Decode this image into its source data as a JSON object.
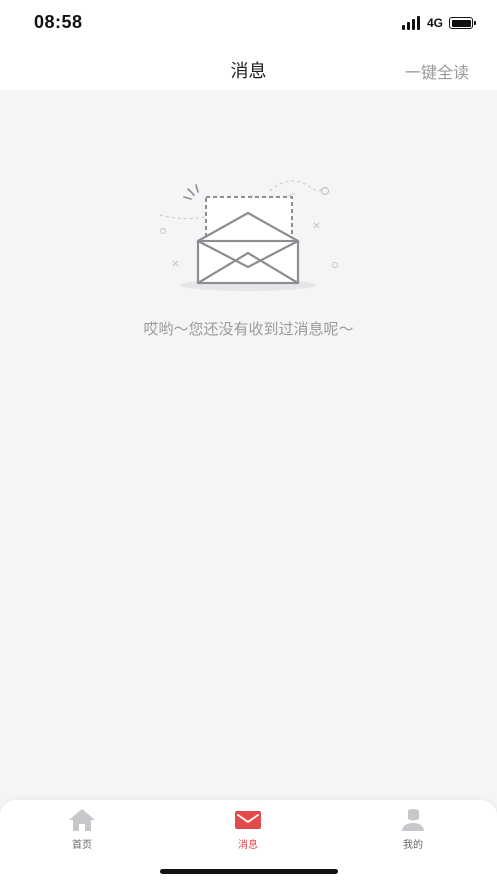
{
  "status_bar": {
    "time": "08:58",
    "network": "4G"
  },
  "nav": {
    "title": "消息",
    "action_label": "一键全读"
  },
  "empty_state": {
    "message": "哎哟～您还没有收到过消息呢～",
    "icon": "open-envelope-icon"
  },
  "tab_bar": {
    "active_color": "#e24b4b",
    "items": [
      {
        "label": "首页",
        "icon": "home-icon",
        "active": false
      },
      {
        "label": "消息",
        "icon": "mail-icon",
        "active": true
      },
      {
        "label": "我的",
        "icon": "user-icon",
        "active": false
      }
    ]
  }
}
